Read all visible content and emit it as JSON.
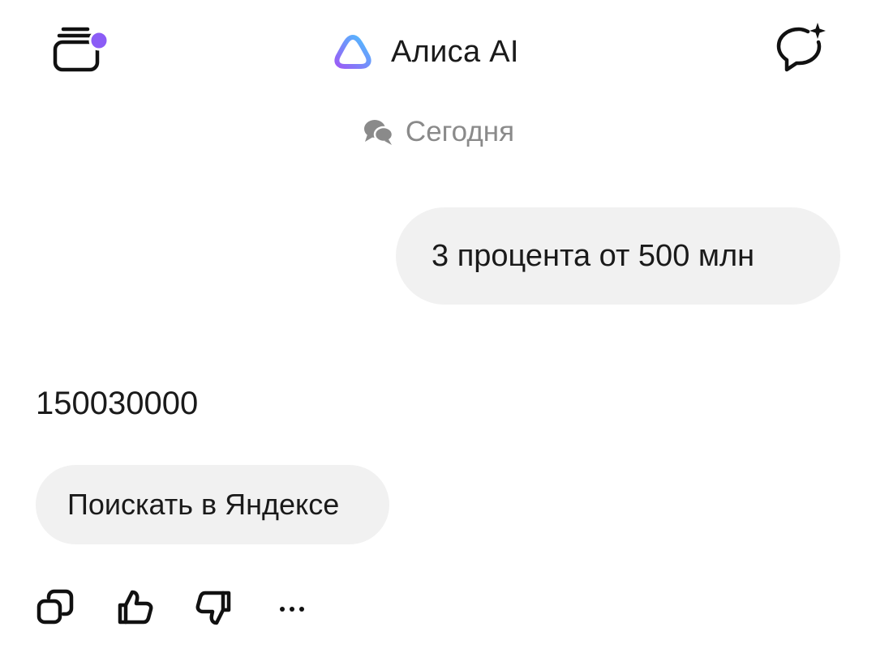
{
  "header": {
    "title": "Алиса AI",
    "left_icon": "chats-stack-icon",
    "right_icon": "new-chat-sparkle-icon",
    "logo_icon": "alice-logo-icon",
    "notification_dot_color": "#8b5cf6"
  },
  "date_separator": {
    "label": "Сегодня",
    "icon": "chat-bubbles-icon"
  },
  "messages": {
    "user": "3 процента от 500 млн",
    "assistant": "150030000"
  },
  "search_button": {
    "label": "Поискать в Яндексе"
  },
  "actions": [
    {
      "icon": "copy-icon"
    },
    {
      "icon": "thumbs-up-icon"
    },
    {
      "icon": "thumbs-down-icon"
    },
    {
      "icon": "more-icon"
    }
  ],
  "colors": {
    "bubble_bg": "#f1f1f1",
    "muted_text": "#8a8a8a",
    "logo_gradient": [
      "#9b5cf6",
      "#4cc3ff"
    ]
  }
}
